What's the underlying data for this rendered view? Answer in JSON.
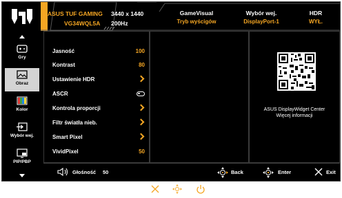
{
  "header": {
    "brand": "ASUS TUF GAMING",
    "model": "VG34WQL5A",
    "resolution": "3440 x 1440",
    "refresh_rate": "200Hz",
    "gamevisual_label": "GameVisual",
    "gamevisual_value": "Tryb wyścigów",
    "input_label": "Wybór wej.",
    "input_value": "DisplayPort-1",
    "hdr_label": "HDR",
    "hdr_value": "WYŁ."
  },
  "sidebar": {
    "items": [
      {
        "label": "Gry",
        "icon": "gamepad-icon"
      },
      {
        "label": "Obraz",
        "icon": "image-icon"
      },
      {
        "label": "Kolor",
        "icon": "color-icon"
      },
      {
        "label": "Wybór wej.",
        "icon": "input-icon"
      },
      {
        "label": "PIP/PBP",
        "icon": "pip-icon"
      }
    ],
    "active_index": 1
  },
  "menu": {
    "items": [
      {
        "label": "Jasność",
        "value": "100",
        "kind": "value"
      },
      {
        "label": "Kontrast",
        "value": "80",
        "kind": "value"
      },
      {
        "label": "Ustawienie HDR",
        "kind": "submenu"
      },
      {
        "label": "ASCR",
        "kind": "toggle"
      },
      {
        "label": "Kontrola proporcji",
        "kind": "submenu"
      },
      {
        "label": "Filtr światła nieb.",
        "kind": "submenu"
      },
      {
        "label": "Smart Pixel",
        "kind": "submenu"
      },
      {
        "label": "VividPixel",
        "value": "50",
        "kind": "value"
      }
    ]
  },
  "info": {
    "line1": "ASUS DisplayWidget Center",
    "line2": "Więcej informacji"
  },
  "footer": {
    "volume_label": "Głośność",
    "volume_value": "50",
    "back_label": "Back",
    "enter_label": "Enter",
    "exit_label": "Exit"
  },
  "colors": {
    "accent": "#f5a623",
    "background": "#000000",
    "text": "#ffffff",
    "active_tab": "#d4d4d4"
  }
}
